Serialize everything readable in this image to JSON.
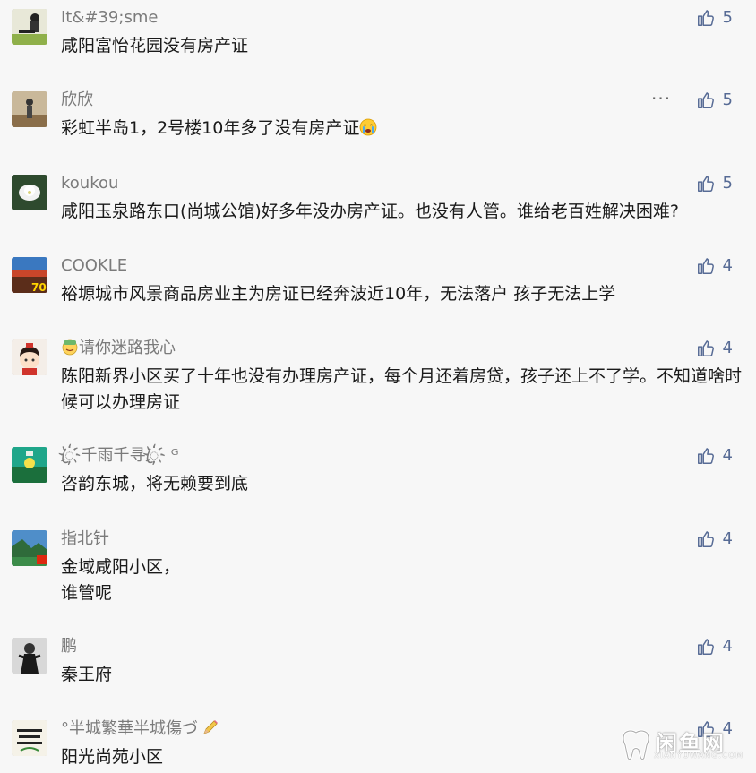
{
  "comments": [
    {
      "username": "It&#39;sme",
      "text": "咸阳富怡花园没有房产证",
      "likes": "5"
    },
    {
      "username": "欣欣",
      "text": "彩虹半岛1，2号楼10年多了没有房产证",
      "likes": "5",
      "more": "···"
    },
    {
      "username": "koukou",
      "text": "咸阳玉泉路东口(尚城公馆)好多年没办房产证。也没有人管。谁给老百姓解决困难?",
      "likes": "5"
    },
    {
      "username": "COOKLE",
      "text": "裕塬城市风景商品房业主为房证已经奔波近10年，无法落户  孩子无法上学",
      "likes": "4"
    },
    {
      "username": "请你迷路我心",
      "text": "陈阳新界小区买了十年也没有办理房产证，每个月还着房贷，孩子还上不了学。不知道啥时候可以办理房证",
      "likes": "4"
    },
    {
      "username": "ꦿ҉千雨千寻ꦿ҉ ᴳ",
      "text": "咨韵东城，将无赖要到底",
      "likes": "4"
    },
    {
      "username": "指北针",
      "text_lines": [
        "金域咸阳小区，",
        "谁管呢"
      ],
      "likes": "4"
    },
    {
      "username": "鹏",
      "text": "秦王府",
      "likes": "4"
    },
    {
      "username": "°半城繁華半城傷づ",
      "text": "阳光尚苑小区",
      "likes": "4"
    }
  ],
  "watermark": {
    "main": "闲鱼网",
    "sub": "XIANYUWANG.COM"
  },
  "colors": {
    "like": "#576b95",
    "username": "#7b7b7b",
    "text": "#1a1a1a",
    "background": "#f7f7f7"
  },
  "icons": {
    "like": "thumbs-up-icon",
    "more": "more-dots-icon",
    "crying_emoji": "crying-face-icon",
    "smiling_emoji": "smiling-face-icon"
  }
}
